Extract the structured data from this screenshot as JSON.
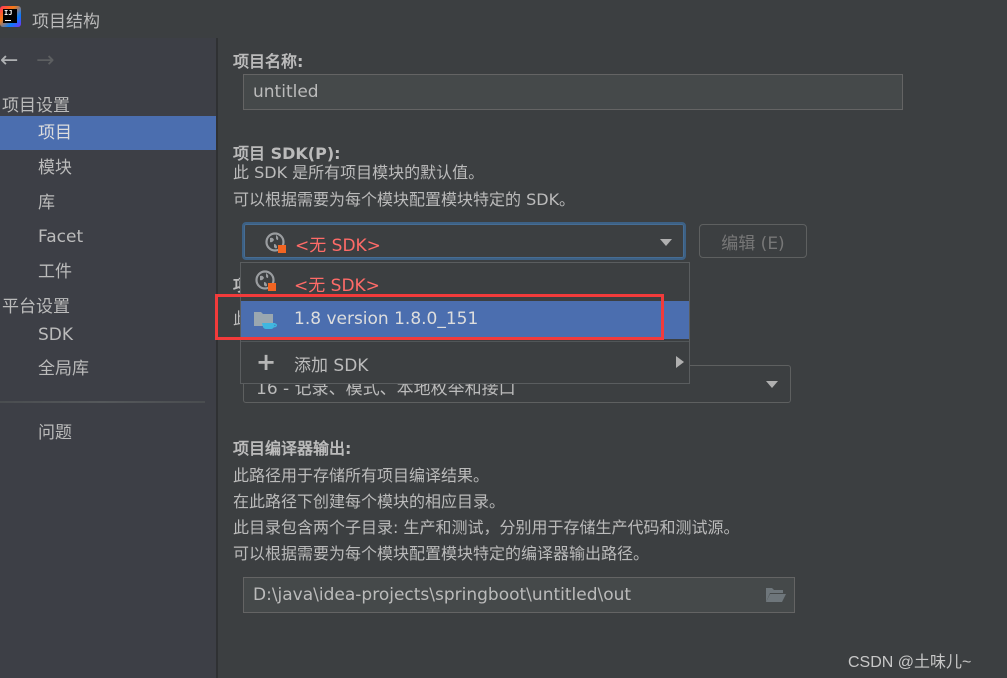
{
  "window": {
    "title": "项目结构",
    "app_logo_text": "IJ"
  },
  "nav": {
    "back_glyph": "←",
    "forward_glyph": "→"
  },
  "sidebar": {
    "groups": [
      {
        "label": "项目设置",
        "items": [
          {
            "label": "项目",
            "selected": true
          },
          {
            "label": "模块",
            "selected": false
          },
          {
            "label": "库",
            "selected": false
          },
          {
            "label": "Facet",
            "selected": false
          },
          {
            "label": "工件",
            "selected": false
          }
        ]
      },
      {
        "label": "平台设置",
        "items": [
          {
            "label": "SDK",
            "selected": false
          },
          {
            "label": "全局库",
            "selected": false
          }
        ]
      }
    ],
    "problems": "问题"
  },
  "main": {
    "project_name": {
      "label": "项目名称:",
      "value": "untitled"
    },
    "project_sdk": {
      "label": "项目 SDK(P):",
      "desc_line1": "此 SDK 是所有项目模块的默认值。",
      "desc_line2": "可以根据需要为每个模块配置模块特定的 SDK。",
      "selected": "<无 SDK>",
      "edit_button": "编辑 (E)",
      "dropdown_options": [
        {
          "label": "<无 SDK>",
          "icon": "globe-icon",
          "highlighted": false
        },
        {
          "label": "1.8 version 1.8.0_151",
          "icon": "jdk-folder-icon",
          "highlighted": true
        },
        {
          "label": "添加 SDK",
          "icon": "plus-icon",
          "submenu": true
        }
      ]
    },
    "language_level": {
      "label_partial": "项",
      "desc_partial": "此",
      "value": "16 - 记录、模式、本地枚举和接口"
    },
    "compiler_output": {
      "label": "项目编译器输出:",
      "desc_lines": [
        "此路径用于存储所有项目编译结果。",
        "在此路径下创建每个模块的相应目录。",
        "此目录包含两个子目录: 生产和测试，分别用于存储生产代码和测试源。",
        "可以根据需要为每个模块配置模块特定的编译器输出路径。"
      ],
      "path": "D:\\java\\idea-projects\\springboot\\untitled\\out"
    }
  },
  "colors": {
    "accent_selection": "#4b6eaf",
    "error_text": "#ff6b68",
    "highlight_annotation": "#f23b3b",
    "background": "#3c3f41"
  },
  "watermark": "CSDN @土味儿~"
}
